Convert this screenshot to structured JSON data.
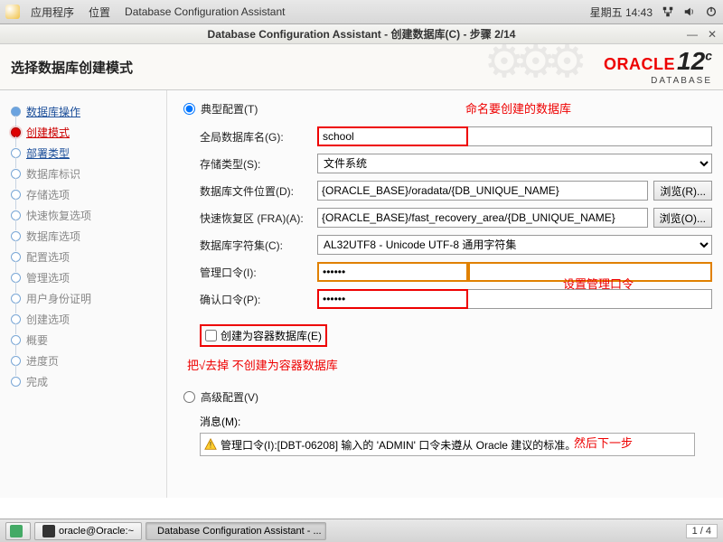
{
  "top": {
    "apps": "应用程序",
    "places": "位置",
    "active": "Database Configuration Assistant",
    "clock": "星期五 14:43"
  },
  "window": {
    "title": "Database Configuration Assistant - 创建数据库(C) - 步骤 2/14"
  },
  "banner": {
    "title": "选择数据库创建模式",
    "brand": "ORACLE",
    "brand_sub": "DATABASE",
    "version": "12",
    "version_sup": "c"
  },
  "sidebar": [
    {
      "label": "数据库操作",
      "link": true
    },
    {
      "label": "创建模式",
      "active": true
    },
    {
      "label": "部署类型",
      "link": true
    },
    {
      "label": "数据库标识"
    },
    {
      "label": "存储选项"
    },
    {
      "label": "快速恢复选项"
    },
    {
      "label": "数据库选项"
    },
    {
      "label": "配置选项"
    },
    {
      "label": "管理选项"
    },
    {
      "label": "用户身份证明"
    },
    {
      "label": "创建选项"
    },
    {
      "label": "概要"
    },
    {
      "label": "进度页"
    },
    {
      "label": "完成"
    }
  ],
  "form": {
    "typical": "典型配置(T)",
    "advanced": "高级配置(V)",
    "global_db_label": "全局数据库名(G):",
    "global_db_value": "school",
    "storage_label": "存储类型(S):",
    "storage_value": "文件系统",
    "dbfile_label": "数据库文件位置(D):",
    "dbfile_value": "{ORACLE_BASE}/oradata/{DB_UNIQUE_NAME}",
    "fra_label": "快速恢复区 (FRA)(A):",
    "fra_value": "{ORACLE_BASE}/fast_recovery_area/{DB_UNIQUE_NAME}",
    "charset_label": "数据库字符集(C):",
    "charset_value": "AL32UTF8 - Unicode UTF-8 通用字符集",
    "admin_pw_label": "管理口令(I):",
    "admin_pw_value": "••••••",
    "confirm_pw_label": "确认口令(P):",
    "confirm_pw_value": "••••••",
    "browse1": "浏览(R)...",
    "browse2": "浏览(O)...",
    "container_chk": "创建为容器数据库(E)",
    "msg_label": "消息(M):",
    "warning": "管理口令(I):[DBT-06208] 输入的 'ADMIN' 口令未遵从 Oracle 建议的标准。"
  },
  "annotations": {
    "a1": "命名要创建的数据库",
    "a2": "设置管理口令",
    "a3": "把√去掉  不创建为容器数据库",
    "a4": "然后下一步"
  },
  "taskbar": {
    "term": "oracle@Oracle:~",
    "dbca": "Database Configuration Assistant - ...",
    "pager": "1 / 4"
  }
}
